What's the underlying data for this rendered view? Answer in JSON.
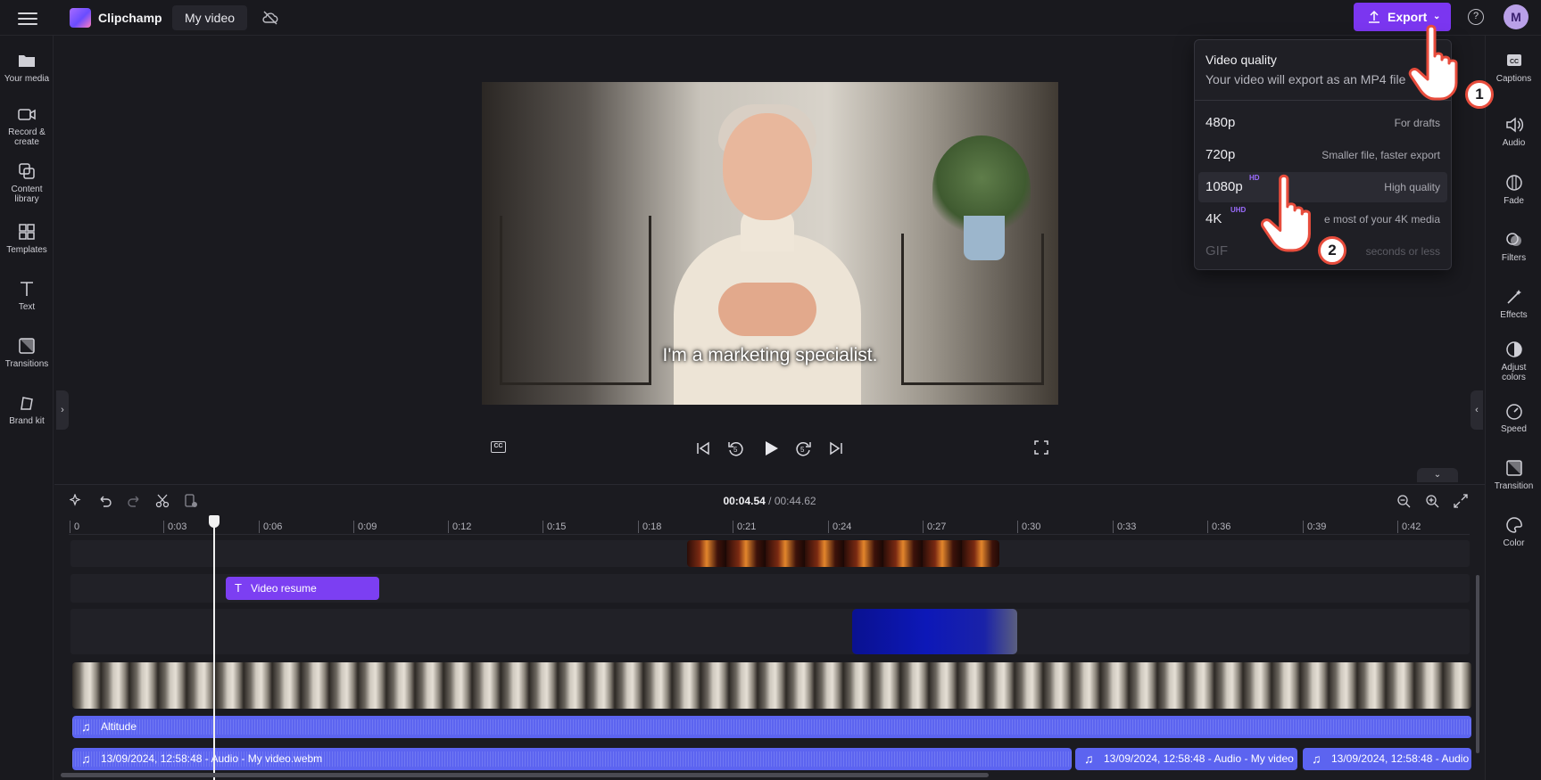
{
  "header": {
    "app_name": "Clipchamp",
    "video_title": "My video",
    "export_label": "Export",
    "avatar_initial": "M"
  },
  "left_sidebar": {
    "items": [
      {
        "label": "Your media",
        "icon": "folder-icon"
      },
      {
        "label": "Record & create",
        "icon": "camera-icon"
      },
      {
        "label": "Content library",
        "icon": "library-icon"
      },
      {
        "label": "Templates",
        "icon": "templates-icon"
      },
      {
        "label": "Text",
        "icon": "text-icon"
      },
      {
        "label": "Transitions",
        "icon": "transitions-icon"
      },
      {
        "label": "Brand kit",
        "icon": "brand-kit-icon"
      }
    ]
  },
  "right_sidebar": {
    "items": [
      {
        "label": "Captions",
        "icon": "captions-icon"
      },
      {
        "label": "Audio",
        "icon": "speaker-icon"
      },
      {
        "label": "Fade",
        "icon": "fade-icon"
      },
      {
        "label": "Filters",
        "icon": "filters-icon"
      },
      {
        "label": "Effects",
        "icon": "magic-wand-icon"
      },
      {
        "label": "Adjust colors",
        "icon": "contrast-icon"
      },
      {
        "label": "Speed",
        "icon": "speedometer-icon"
      },
      {
        "label": "Transition",
        "icon": "transition-icon"
      },
      {
        "label": "Color",
        "icon": "palette-icon"
      }
    ]
  },
  "preview": {
    "caption": "I'm a marketing specialist."
  },
  "export_menu": {
    "title": "Video quality",
    "subtitle": "Your video will export as an MP4 file",
    "options": [
      {
        "quality": "480p",
        "tag": "",
        "description": "For drafts"
      },
      {
        "quality": "720p",
        "tag": "",
        "description": "Smaller file, faster export"
      },
      {
        "quality": "1080p",
        "tag": "HD",
        "description": "High quality"
      },
      {
        "quality": "4K",
        "tag": "UHD",
        "description": "e most of your 4K media"
      },
      {
        "quality": "GIF",
        "tag": "",
        "description": "seconds or less"
      }
    ],
    "step_badges": [
      "1",
      "2"
    ]
  },
  "timeline": {
    "current_time": "00:04.54",
    "separator": " / ",
    "total_time": "00:44.62",
    "ruler_ticks": [
      "0",
      "0:03",
      "0:06",
      "0:09",
      "0:12",
      "0:15",
      "0:18",
      "0:21",
      "0:24",
      "0:27",
      "0:30",
      "0:33",
      "0:36",
      "0:39",
      "0:42"
    ],
    "text_clip": "Video resume",
    "audio_clip_1": "Altitude",
    "audio_clip_2": "13/09/2024, 12:58:48 - Audio - My video.webm",
    "audio_clip_3": "13/09/2024, 12:58:48 - Audio - My video",
    "audio_clip_4": "13/09/2024, 12:58:48 - Audio -"
  },
  "colors": {
    "accent": "#7b36f0",
    "audio_clip": "#5c64f0",
    "background": "#1a1a1f"
  }
}
